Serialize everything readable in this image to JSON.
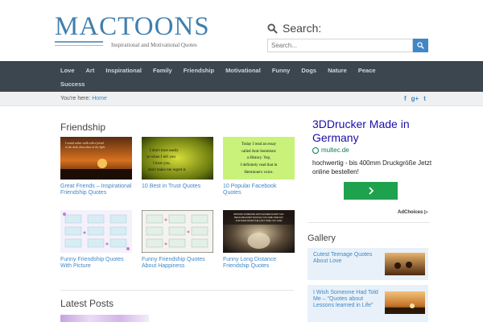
{
  "site": {
    "logo_text": "MACTOONS",
    "tagline": "Inspirational and Motivational Quotes"
  },
  "search": {
    "label": "Search:",
    "placeholder": "Search..."
  },
  "nav": {
    "items": [
      "Love",
      "Art",
      "Inspirational",
      "Family",
      "Friendship",
      "Motivational",
      "Funny",
      "Dogs",
      "Nature",
      "Peace",
      "Success"
    ]
  },
  "breadcrumb": {
    "prefix": "You're here:",
    "home": "Home"
  },
  "social": {
    "icons": [
      "facebook-icon",
      "google-plus-icon",
      "twitter-icon"
    ],
    "labels": [
      "f",
      "g+",
      "t"
    ]
  },
  "main": {
    "section_title": "Friendship",
    "cards": [
      {
        "title": "Great Friends – Inspirational Friendship Quotes",
        "thumb_text": "I would rather walk with a friend in the dark, than alone in the light."
      },
      {
        "title": "10 Best in Trust Quotes",
        "thumb_text": "I don't trust easily so when I tell you I trust you, don't make me regret it."
      },
      {
        "title": "10 Popular Facebook Quotes",
        "thumb_text": "Today I read an essay called Anti-Semitism: a History. Yep, I definitely read that in Hermione's voice."
      },
      {
        "title": "Funny Friendship Quotes With Picture",
        "thumb_text": ""
      },
      {
        "title": "Funny Friendship Quotes About Happiness",
        "thumb_text": ""
      },
      {
        "title": "Funny Long Distance Friendship Quotes",
        "thumb_text": ""
      }
    ],
    "latest_title": "Latest Posts"
  },
  "ad": {
    "title": "3DDrucker Made in Germany",
    "source": "multec.de",
    "text": "hochwertig - bis 400mm Druckgröße Jetzt online bestellen!",
    "adchoices": "AdChoices"
  },
  "gallery": {
    "title": "Gallery",
    "items": [
      {
        "caption": "Cutest Teenage Quotes About Love"
      },
      {
        "caption": "I Wish Someone Had Told Me – \"Quotes about Lessons learned in Life\""
      }
    ]
  },
  "colors": {
    "accent": "#3f87c6",
    "nav_bg": "#3b464f",
    "ad_button": "#1fa24d"
  }
}
